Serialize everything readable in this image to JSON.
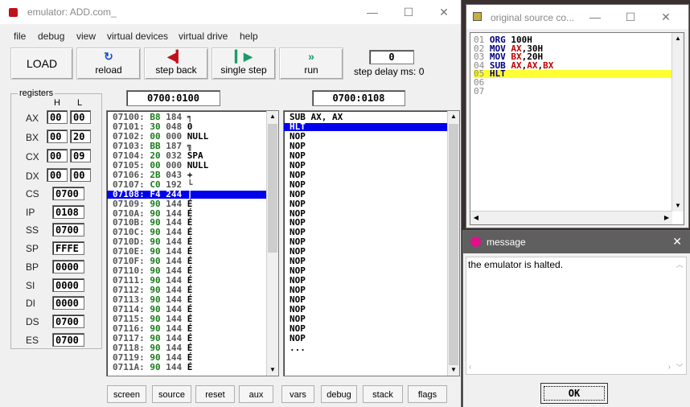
{
  "emulator": {
    "title": "emulator: ADD.com_",
    "menu": [
      "file",
      "debug",
      "view",
      "virtual devices",
      "virtual drive",
      "help"
    ],
    "toolbar": {
      "load": "LOAD",
      "reload": "reload",
      "step_back": "step back",
      "single_step": "single step",
      "run": "run",
      "step_delay_label": "step delay ms: 0",
      "step_delay_value": "0"
    },
    "registers_label": "registers",
    "h_label": "H",
    "l_label": "L",
    "regs_hl": [
      {
        "name": "AX",
        "h": "00",
        "l": "00"
      },
      {
        "name": "BX",
        "h": "00",
        "l": "20"
      },
      {
        "name": "CX",
        "h": "00",
        "l": "09"
      },
      {
        "name": "DX",
        "h": "00",
        "l": "00"
      }
    ],
    "regs16": [
      {
        "name": "CS",
        "v": "0700"
      },
      {
        "name": "IP",
        "v": "0108"
      },
      {
        "name": "SS",
        "v": "0700"
      },
      {
        "name": "SP",
        "v": "FFFE"
      },
      {
        "name": "BP",
        "v": "0000"
      },
      {
        "name": "SI",
        "v": "0000"
      },
      {
        "name": "DI",
        "v": "0000"
      },
      {
        "name": "DS",
        "v": "0700"
      },
      {
        "name": "ES",
        "v": "0700"
      }
    ],
    "mem_addr": "0700:0100",
    "dis_addr": "0700:0108",
    "memory": [
      {
        "a": "07100:",
        "v": "B8",
        "d": "184",
        "c": "╕"
      },
      {
        "a": "07101:",
        "v": "30",
        "d": "048",
        "c": "0"
      },
      {
        "a": "07102:",
        "v": "00",
        "d": "000",
        "c": "NULL"
      },
      {
        "a": "07103:",
        "v": "BB",
        "d": "187",
        "c": "╗"
      },
      {
        "a": "07104:",
        "v": "20",
        "d": "032",
        "c": "SPA"
      },
      {
        "a": "07105:",
        "v": "00",
        "d": "000",
        "c": "NULL"
      },
      {
        "a": "07106:",
        "v": "2B",
        "d": "043",
        "c": "+"
      },
      {
        "a": "07107:",
        "v": "C0",
        "d": "192",
        "c": "└"
      },
      {
        "a": "07108:",
        "v": "F4",
        "d": "244",
        "c": "⌠"
      },
      {
        "a": "07109:",
        "v": "90",
        "d": "144",
        "c": "É"
      },
      {
        "a": "0710A:",
        "v": "90",
        "d": "144",
        "c": "É"
      },
      {
        "a": "0710B:",
        "v": "90",
        "d": "144",
        "c": "É"
      },
      {
        "a": "0710C:",
        "v": "90",
        "d": "144",
        "c": "É"
      },
      {
        "a": "0710D:",
        "v": "90",
        "d": "144",
        "c": "É"
      },
      {
        "a": "0710E:",
        "v": "90",
        "d": "144",
        "c": "É"
      },
      {
        "a": "0710F:",
        "v": "90",
        "d": "144",
        "c": "É"
      },
      {
        "a": "07110:",
        "v": "90",
        "d": "144",
        "c": "É"
      },
      {
        "a": "07111:",
        "v": "90",
        "d": "144",
        "c": "É"
      },
      {
        "a": "07112:",
        "v": "90",
        "d": "144",
        "c": "É"
      },
      {
        "a": "07113:",
        "v": "90",
        "d": "144",
        "c": "É"
      },
      {
        "a": "07114:",
        "v": "90",
        "d": "144",
        "c": "É"
      },
      {
        "a": "07115:",
        "v": "90",
        "d": "144",
        "c": "É"
      },
      {
        "a": "07116:",
        "v": "90",
        "d": "144",
        "c": "É"
      },
      {
        "a": "07117:",
        "v": "90",
        "d": "144",
        "c": "É"
      },
      {
        "a": "07118:",
        "v": "90",
        "d": "144",
        "c": "É"
      },
      {
        "a": "07119:",
        "v": "90",
        "d": "144",
        "c": "É"
      },
      {
        "a": "0711A:",
        "v": "90",
        "d": "144",
        "c": "É"
      }
    ],
    "mem_selected_index": 8,
    "disasm": [
      "SUB AX, AX",
      "HLT",
      "NOP",
      "NOP",
      "NOP",
      "NOP",
      "NOP",
      "NOP",
      "NOP",
      "NOP",
      "NOP",
      "NOP",
      "NOP",
      "NOP",
      "NOP",
      "NOP",
      "NOP",
      "NOP",
      "NOP",
      "NOP",
      "NOP",
      "NOP",
      "NOP",
      "NOP",
      "..."
    ],
    "dis_selected_index": 1,
    "bottom_buttons": [
      "screen",
      "source",
      "reset",
      "aux",
      "vars",
      "debug",
      "stack",
      "flags"
    ]
  },
  "source": {
    "title": "original source co...",
    "lines": [
      {
        "n": "01",
        "t": [
          [
            "kw",
            "ORG "
          ],
          [
            "nm",
            "100H"
          ]
        ]
      },
      {
        "n": "02",
        "t": [
          [
            "kw",
            "MOV "
          ],
          [
            "rg",
            "AX"
          ],
          [
            "nm",
            ",30H"
          ]
        ]
      },
      {
        "n": "03",
        "t": [
          [
            "kw",
            "MOV "
          ],
          [
            "rg",
            "BX"
          ],
          [
            "nm",
            ",20H"
          ]
        ]
      },
      {
        "n": "04",
        "t": [
          [
            "kw",
            "SUB "
          ],
          [
            "rg",
            "AX"
          ],
          [
            "nm",
            ","
          ],
          [
            "rg",
            "AX"
          ],
          [
            "nm",
            ","
          ],
          [
            "rg",
            "BX"
          ]
        ]
      },
      {
        "n": "05",
        "t": [
          [
            "kw",
            "HLT"
          ]
        ]
      },
      {
        "n": "06",
        "t": []
      },
      {
        "n": "07",
        "t": []
      }
    ],
    "highlight_line": 5
  },
  "message": {
    "title": "message",
    "text": "the emulator is halted.",
    "ok": "OK"
  },
  "colors": {
    "selection": "#0000ee",
    "highlight": "#ffff33",
    "icon_red": "#c0101a",
    "accent_blue": "#1a50c8",
    "accent_green": "#1a9a6a"
  }
}
